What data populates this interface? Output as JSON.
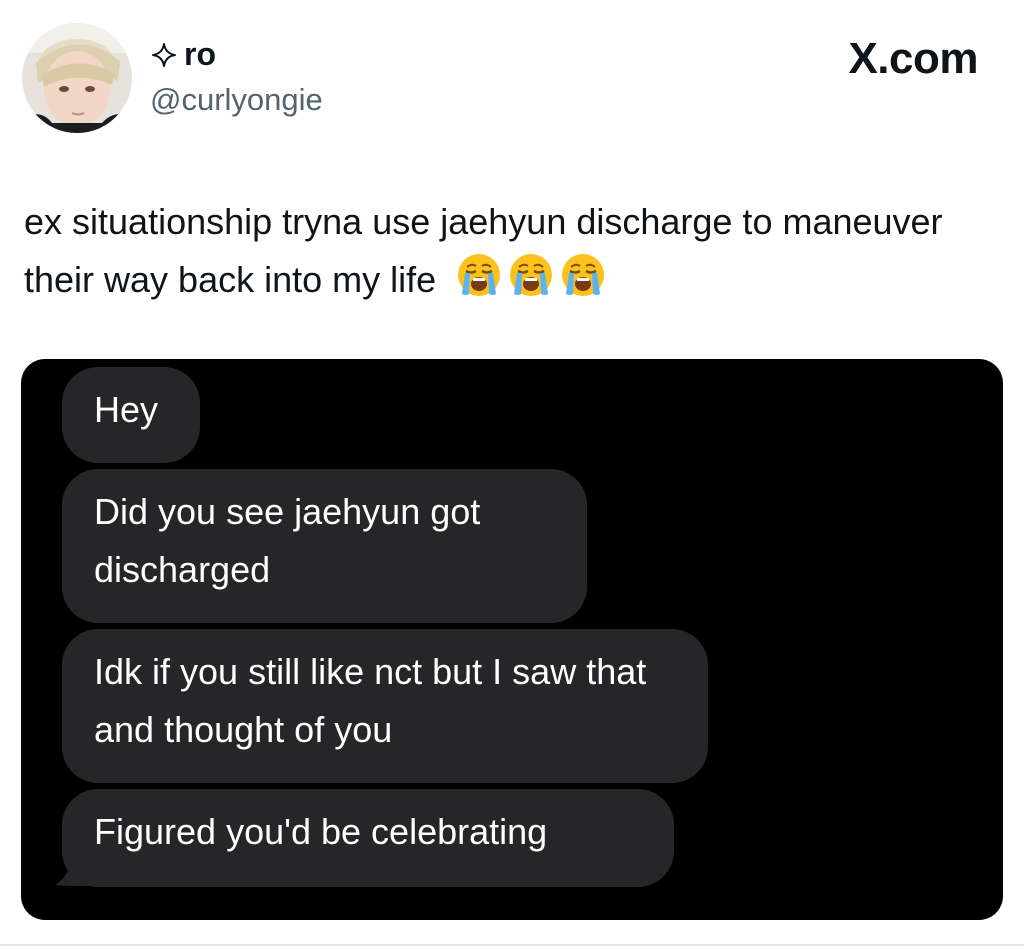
{
  "author": {
    "display_name": "ro",
    "handle": "@curlyongie",
    "badge_icon": "sparkle-icon"
  },
  "source_label": "X.com",
  "tweet": {
    "text": "ex situationship tryna use jaehyun discharge to maneuver their way back into my life",
    "emojis": [
      "😭",
      "😭",
      "😭"
    ]
  },
  "messages": [
    {
      "text": "Hey"
    },
    {
      "text": "Did you see jaehyun got discharged"
    },
    {
      "text": "Idk if you still like nct but I saw that and thought of you"
    },
    {
      "text": "Figured you'd be celebrating"
    }
  ],
  "colors": {
    "bubble": "#262629",
    "media_bg": "#000000",
    "handle": "#536471",
    "text": "#0f1419"
  }
}
